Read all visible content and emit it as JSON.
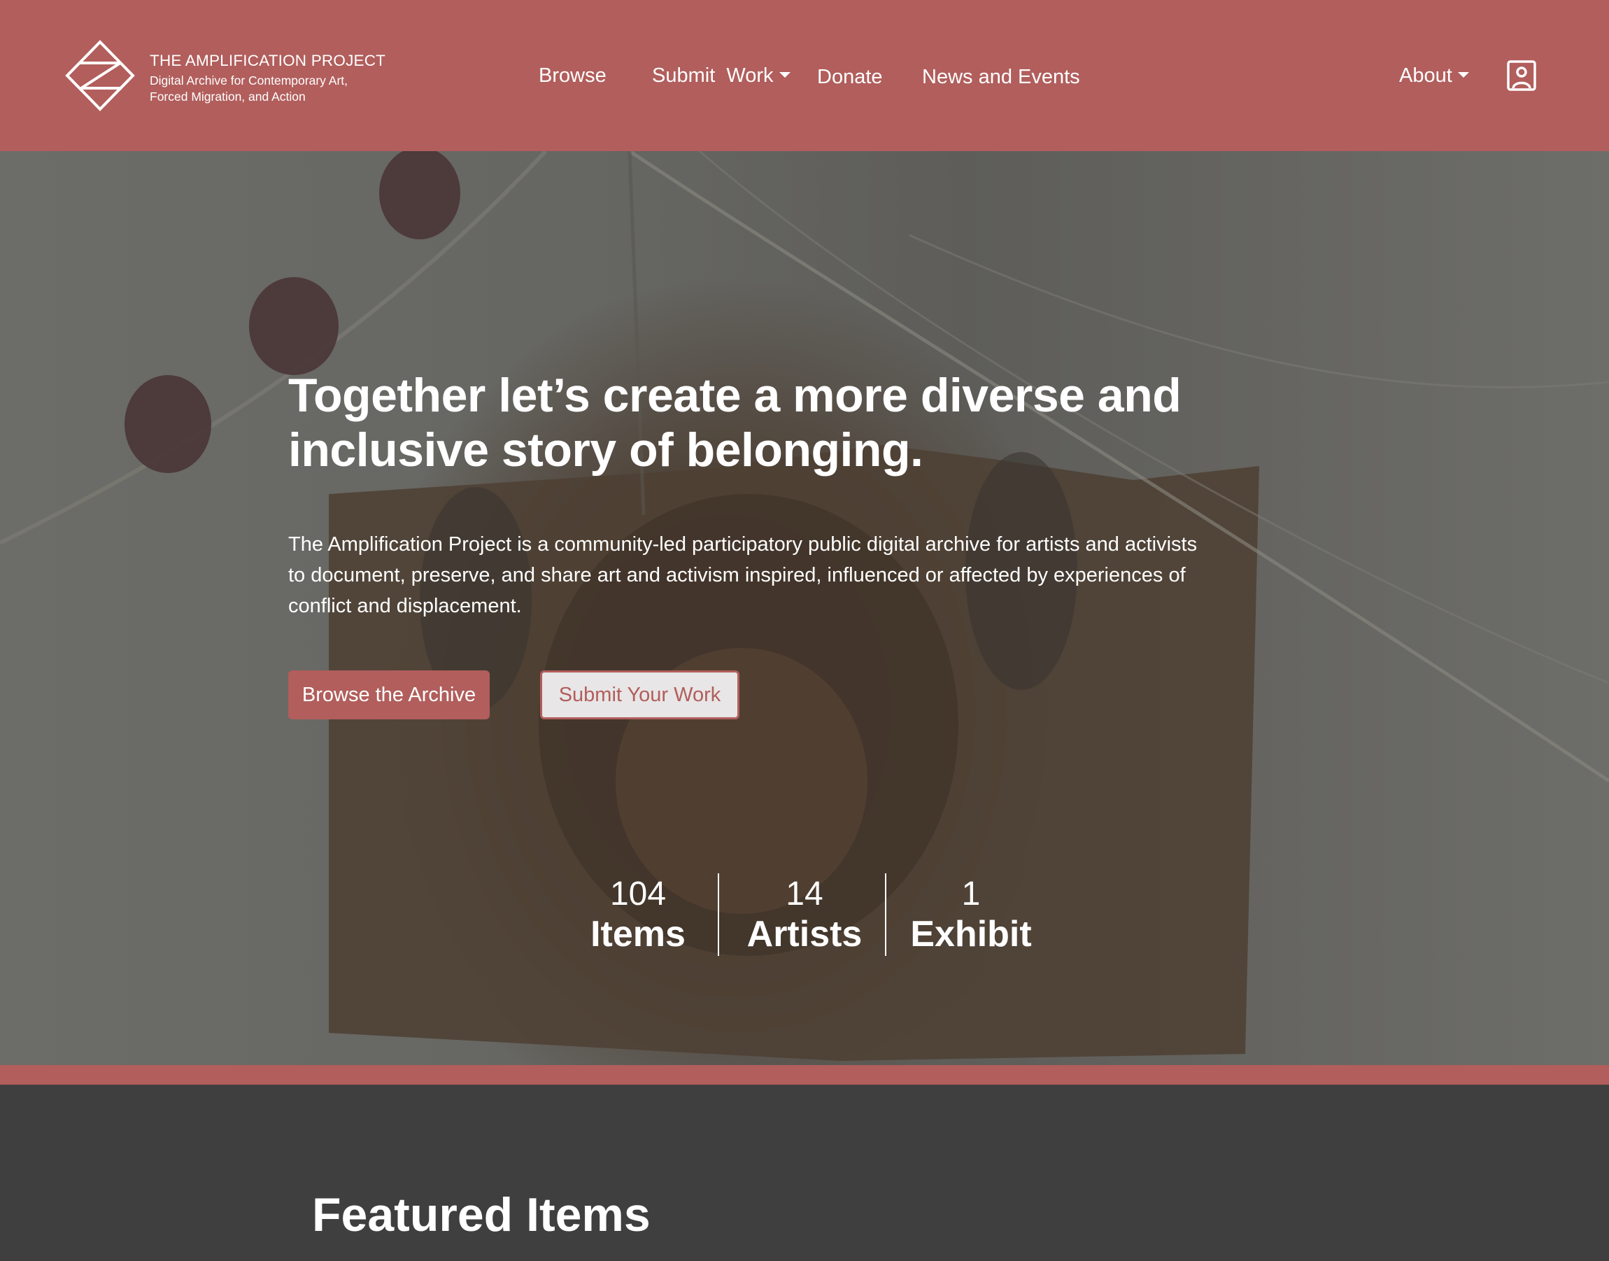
{
  "header": {
    "brand_title": "THE AMPLIFICATION PROJECT",
    "brand_subtitle": "Digital Archive for Contemporary Art, Forced Migration, and Action",
    "logo_icon": "diamond-logo-icon",
    "nav": {
      "browse": "Browse",
      "submit_work": "Submit  Work",
      "donate": "Donate",
      "news_events": "News and Events",
      "about": "About"
    },
    "user_icon": "user-account-icon"
  },
  "hero": {
    "title": "Together let’s create a more diverse and inclusive story of belonging.",
    "description": "The Amplification Project is a community-led participatory public digital archive for artists and activists to document, preserve, and share art and activism inspired, influenced or affected by experiences of conflict and displacement.",
    "primary_button": "Browse the Archive",
    "secondary_button": "Submit Your Work",
    "stats": [
      {
        "value": "104",
        "label": "Items"
      },
      {
        "value": "14",
        "label": "Artists"
      },
      {
        "value": "1",
        "label": "Exhibit"
      }
    ],
    "scroll_icon": "chevron-down-icon"
  },
  "featured": {
    "title": "Featured Items"
  },
  "colors": {
    "brand": "#b15e5c",
    "dark": "#3f3f3f",
    "text_light": "#ffffff"
  }
}
